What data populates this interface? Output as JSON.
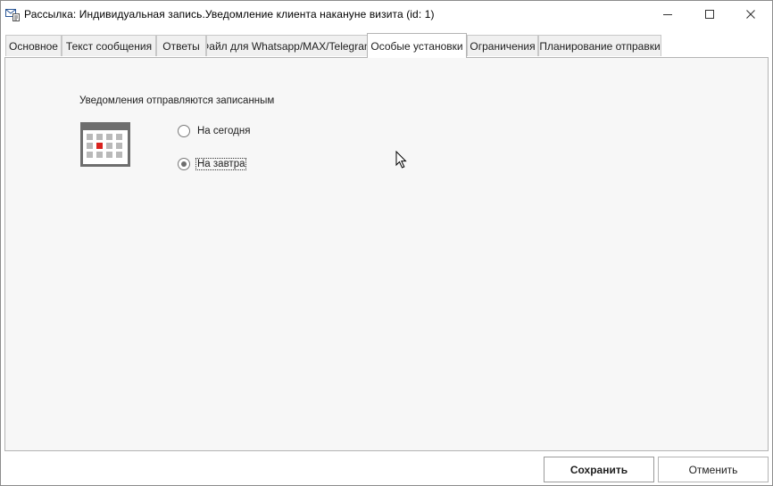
{
  "window": {
    "title": "Рассылка: Индивидуальная запись.Уведомление клиента накануне визита (id: 1)",
    "controls": [
      "minimize-icon",
      "maximize-icon",
      "close-icon"
    ]
  },
  "tabs": [
    {
      "label": "Основное",
      "active": false
    },
    {
      "label": "Текст сообщения",
      "active": false
    },
    {
      "label": "Ответы",
      "active": false
    },
    {
      "label": "Файл для Whatsapp/MAX/Telegram",
      "active": false
    },
    {
      "label": "Особые установки",
      "active": true
    },
    {
      "label": "Ограничения",
      "active": false
    },
    {
      "label": "Планирование отправки",
      "active": false
    }
  ],
  "settings": {
    "section_label": "Уведомления отправляются записанным",
    "icon": "calendar-icon",
    "options": [
      {
        "label": "На сегодня",
        "selected": false
      },
      {
        "label": "На завтра",
        "selected": true
      }
    ]
  },
  "footer": {
    "save_label": "Сохранить",
    "cancel_label": "Отменить"
  },
  "colors": {
    "calendar_gray": "#6e6e6e",
    "calendar_accent": "#d9231f",
    "panel_bg": "#f7f7f7",
    "tab_bg": "#f0f0f0"
  }
}
